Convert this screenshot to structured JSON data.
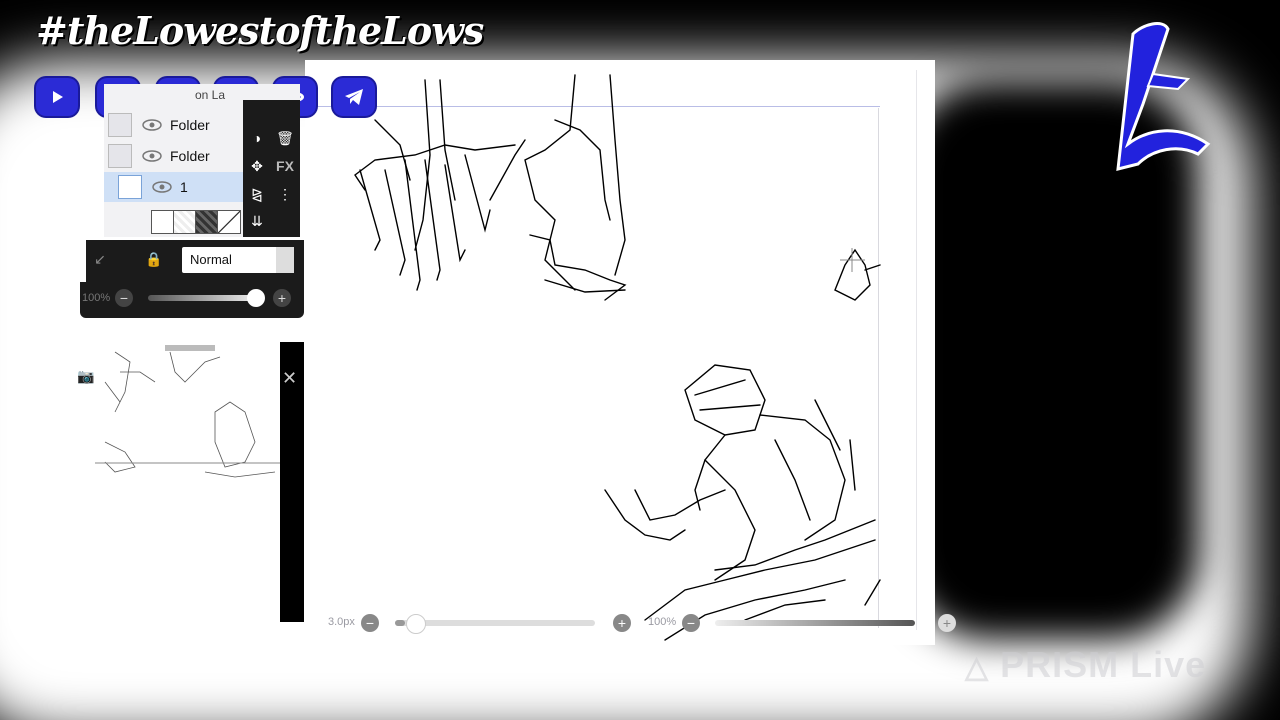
{
  "overlay": {
    "title": "#theLowestoftheLows",
    "social_icons": [
      "youtube-icon",
      "kick-icon",
      "tiktok-icon",
      "snapchat-icon",
      "rumble-icon",
      "telegram-icon"
    ],
    "brand_color": "#2b2bd6"
  },
  "layers": {
    "top_label": "on La",
    "rows": [
      {
        "name": "Folder",
        "selected": false
      },
      {
        "name": "Folder",
        "selected": false
      },
      {
        "name": "1",
        "selected": true
      }
    ],
    "tools": [
      "fill-icon",
      "trash-icon",
      "move-icon",
      "fx-label",
      "flip-icon",
      "more-icon",
      "merge-icon"
    ],
    "fx_label": "FX"
  },
  "blend": {
    "mode": "Normal"
  },
  "opacity": {
    "label": "100%",
    "value": 1.0
  },
  "brush": {
    "size_label": "3.0px",
    "size_value": 0.05
  },
  "zoom": {
    "label": "100%",
    "value": 1.0
  },
  "watermark": {
    "text": "PRISM Live"
  }
}
